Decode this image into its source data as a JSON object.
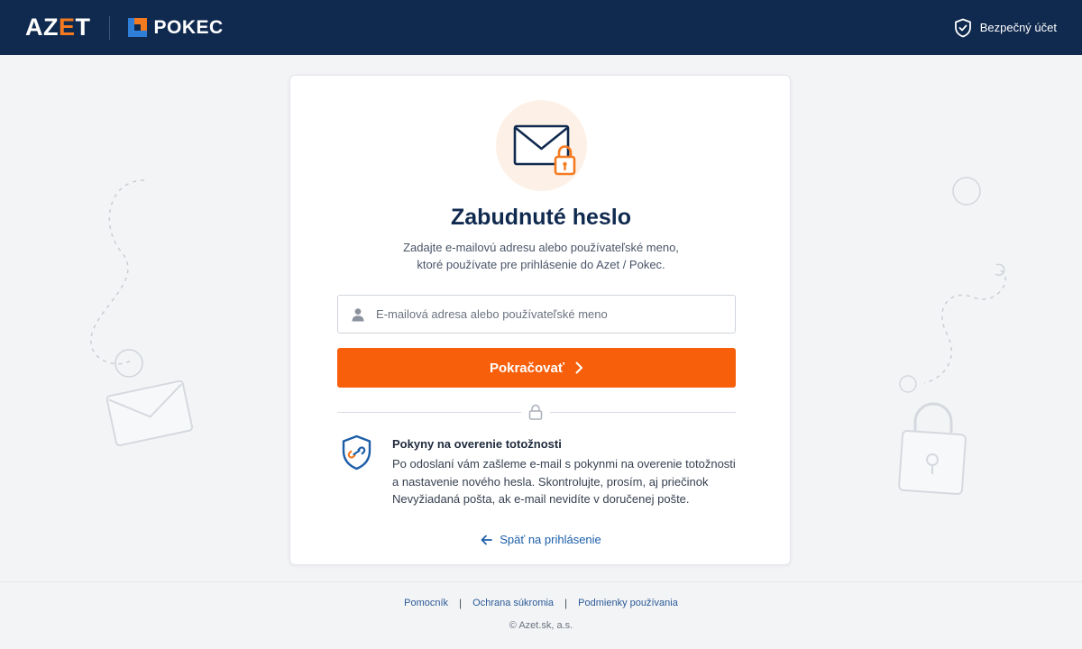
{
  "header": {
    "brand_azet_prefix": "AZ",
    "brand_azet_e": "E",
    "brand_azet_suffix": "T",
    "brand_pokec": "POKEC",
    "secure_account_label": "Bezpečný účet"
  },
  "card": {
    "title": "Zabudnuté heslo",
    "subtitle_line1": "Zadajte e-mailovú adresu alebo používateľské meno,",
    "subtitle_line2": "ktoré používate pre prihlásenie do Azet / Pokec.",
    "input": {
      "placeholder": "E-mailová adresa alebo používateľské meno",
      "value": ""
    },
    "continue_button_label": "Pokračovať",
    "info": {
      "title": "Pokyny na overenie totožnosti",
      "text_line1": "Po odoslaní vám zašleme e-mail s pokynmi na overenie totožnosti",
      "text_line2": "a nastavenie nového hesla. Skontrolujte, prosím, aj priečinok",
      "text_line3": "Nevyžiadaná pošta, ak e-mail nevidíte v doručenej pošte."
    },
    "back_link_label": "Späť na prihlásenie"
  },
  "footer": {
    "links": [
      "Pomocník",
      "Ochrana súkromia",
      "Podmienky používania"
    ],
    "separator": "|",
    "copyright": "© Azet.sk, a.s."
  },
  "colors": {
    "header_bg": "#102a4f",
    "accent_orange": "#f75f0b",
    "link_blue": "#1c5ea8",
    "title_navy": "#102a4f"
  },
  "icons": {
    "secure": "shield-check-icon",
    "hero": "envelope-lock-icon",
    "input": "user-icon",
    "button": "chevron-right-icon",
    "divider": "lock-icon",
    "info": "shield-link-icon",
    "back": "arrow-left-icon"
  }
}
